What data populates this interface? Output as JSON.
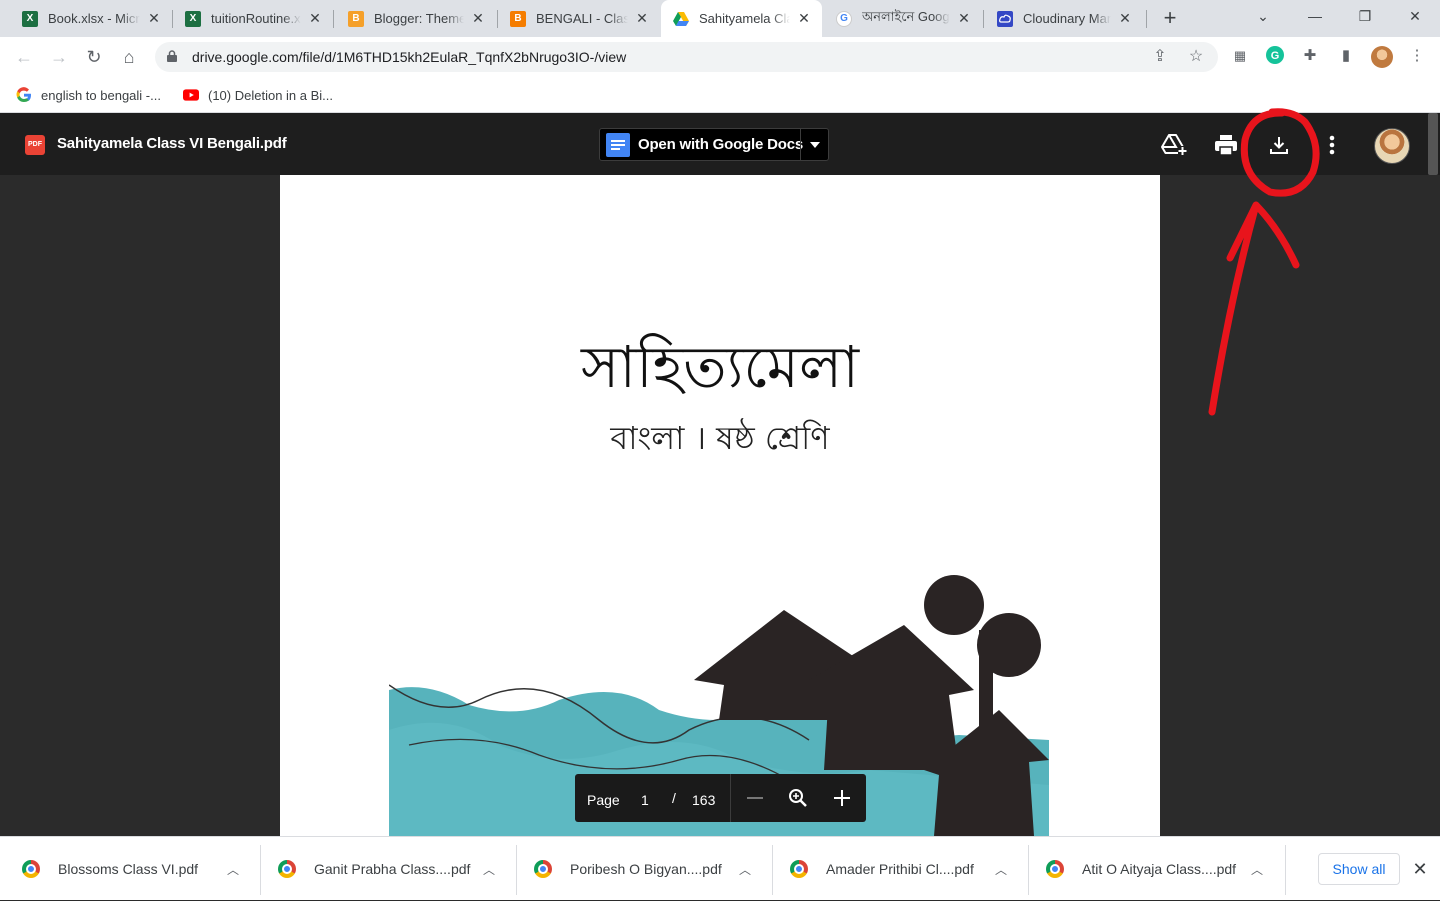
{
  "tabs": [
    {
      "title": "Book.xlsx - Microsoft Excel",
      "icon": "excel-icon",
      "color": "#1d6f42",
      "letter": "X"
    },
    {
      "title": "tuitionRoutine.xlsx",
      "icon": "excel-icon",
      "color": "#1d6f42",
      "letter": "X"
    },
    {
      "title": "Blogger: Theme",
      "icon": "blogger-icon",
      "color": "#f5a02a",
      "letter": "B"
    },
    {
      "title": "BENGALI - Class",
      "icon": "blogger-icon",
      "color": "#f57d00",
      "letter": "B"
    },
    {
      "title": "Sahityamela Class VI Bengali.pdf",
      "icon": "google-drive-icon",
      "color": "#fbbc04",
      "letter": ""
    },
    {
      "title": "অনলাইনে Google",
      "icon": "google-icon",
      "color": "#4285f4",
      "letter": "G"
    },
    {
      "title": "Cloudinary Management",
      "icon": "cloudinary-icon",
      "color": "#3448c5",
      "letter": ""
    }
  ],
  "address_bar": {
    "url": "drive.google.com/file/d/1M6THD15kh2EulaR_TqnfX2bNrugo3IO-/view"
  },
  "bookmarks": [
    {
      "label": "english to bengali -...",
      "icon": "google-icon"
    },
    {
      "label": "(10) Deletion in a Bi...",
      "icon": "youtube-icon"
    }
  ],
  "drive": {
    "file_icon_text": "PDF",
    "file_title": "Sahityamela Class VI Bengali.pdf",
    "open_with_label": "Open with Google Docs"
  },
  "document": {
    "title": "সাহিত্যমেলা",
    "subtitle": "বাংলা । ষষ্ঠ শ্রেণি"
  },
  "page_control": {
    "label": "Page",
    "current": "1",
    "separator": "/",
    "total": "163"
  },
  "downloads": [
    {
      "name": "Blossoms Class VI.pdf"
    },
    {
      "name": "Ganit Prabha Class....pdf"
    },
    {
      "name": "Poribesh O Bigyan....pdf"
    },
    {
      "name": "Amader Prithibi Cl....pdf"
    },
    {
      "name": "Atit O Aityaja Class....pdf"
    }
  ],
  "show_all_label": "Show all",
  "colors": {
    "annotation": "#e8141c",
    "drive_bar": "#1e1e1e",
    "docs_blue": "#4285f4"
  }
}
